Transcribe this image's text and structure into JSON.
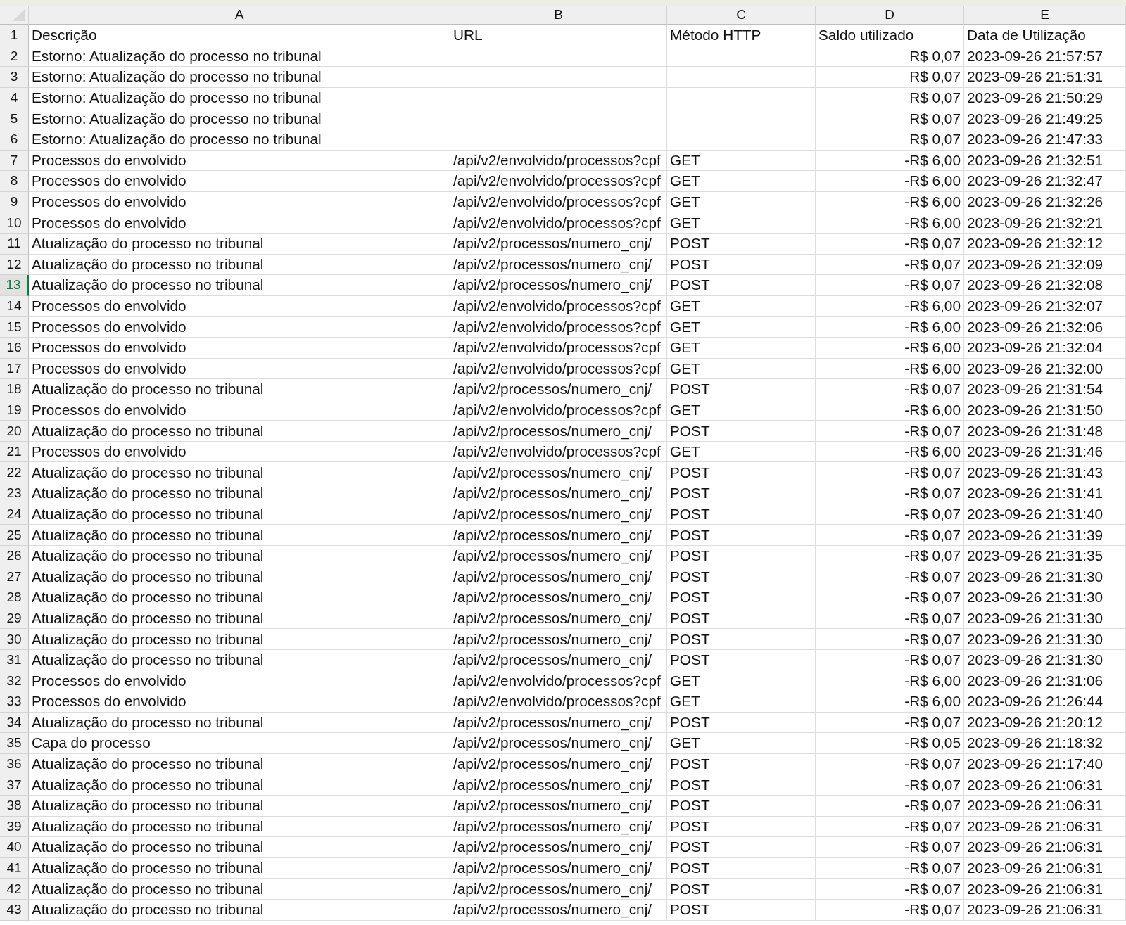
{
  "columns": [
    {
      "letter": "A"
    },
    {
      "letter": "B"
    },
    {
      "letter": "C"
    },
    {
      "letter": "D"
    },
    {
      "letter": "E"
    }
  ],
  "header_row": {
    "number": "1",
    "selected": false,
    "cells": [
      "Descrição",
      "URL",
      "Método HTTP",
      "Saldo utilizado",
      "Data de Utilização"
    ]
  },
  "rows": [
    {
      "number": "2",
      "selected": false,
      "description": "Estorno: Atualização do processo no tribunal",
      "balance": "R$ 0,07",
      "date": "2023-09-26 21:57:57"
    },
    {
      "number": "3",
      "selected": false,
      "description": "Estorno: Atualização do processo no tribunal",
      "balance": "R$ 0,07",
      "date": "2023-09-26 21:51:31"
    },
    {
      "number": "4",
      "selected": false,
      "description": "Estorno: Atualização do processo no tribunal",
      "balance": "R$ 0,07",
      "date": "2023-09-26 21:50:29"
    },
    {
      "number": "5",
      "selected": false,
      "description": "Estorno: Atualização do processo no tribunal",
      "balance": "R$ 0,07",
      "date": "2023-09-26 21:49:25"
    },
    {
      "number": "6",
      "selected": false,
      "description": "Estorno: Atualização do processo no tribunal",
      "balance": "R$ 0,07",
      "date": "2023-09-26 21:47:33"
    },
    {
      "number": "7",
      "selected": false,
      "description": "Processos do envolvido",
      "url": "/api/v2/envolvido/processos?cpf",
      "method": "GET",
      "balance": "-R$ 6,00",
      "date": "2023-09-26 21:32:51"
    },
    {
      "number": "8",
      "selected": false,
      "description": "Processos do envolvido",
      "url": "/api/v2/envolvido/processos?cpf",
      "method": "GET",
      "balance": "-R$ 6,00",
      "date": "2023-09-26 21:32:47"
    },
    {
      "number": "9",
      "selected": false,
      "description": "Processos do envolvido",
      "url": "/api/v2/envolvido/processos?cpf",
      "method": "GET",
      "balance": "-R$ 6,00",
      "date": "2023-09-26 21:32:26"
    },
    {
      "number": "10",
      "selected": false,
      "description": "Processos do envolvido",
      "url": "/api/v2/envolvido/processos?cpf",
      "method": "GET",
      "balance": "-R$ 6,00",
      "date": "2023-09-26 21:32:21"
    },
    {
      "number": "11",
      "selected": false,
      "description": "Atualização do processo no tribunal",
      "url": "/api/v2/processos/numero_cnj/",
      "method": "POST",
      "balance": "-R$ 0,07",
      "date": "2023-09-26 21:32:12"
    },
    {
      "number": "12",
      "selected": false,
      "description": "Atualização do processo no tribunal",
      "url": "/api/v2/processos/numero_cnj/",
      "method": "POST",
      "balance": "-R$ 0,07",
      "date": "2023-09-26 21:32:09"
    },
    {
      "number": "13",
      "selected": true,
      "description": "Atualização do processo no tribunal",
      "url": "/api/v2/processos/numero_cnj/",
      "method": "POST",
      "balance": "-R$ 0,07",
      "date": "2023-09-26 21:32:08"
    },
    {
      "number": "14",
      "selected": false,
      "description": "Processos do envolvido",
      "url": "/api/v2/envolvido/processos?cpf",
      "method": "GET",
      "balance": "-R$ 6,00",
      "date": "2023-09-26 21:32:07"
    },
    {
      "number": "15",
      "selected": false,
      "description": "Processos do envolvido",
      "url": "/api/v2/envolvido/processos?cpf",
      "method": "GET",
      "balance": "-R$ 6,00",
      "date": "2023-09-26 21:32:06"
    },
    {
      "number": "16",
      "selected": false,
      "description": "Processos do envolvido",
      "url": "/api/v2/envolvido/processos?cpf",
      "method": "GET",
      "balance": "-R$ 6,00",
      "date": "2023-09-26 21:32:04"
    },
    {
      "number": "17",
      "selected": false,
      "description": "Processos do envolvido",
      "url": "/api/v2/envolvido/processos?cpf",
      "method": "GET",
      "balance": "-R$ 6,00",
      "date": "2023-09-26 21:32:00"
    },
    {
      "number": "18",
      "selected": false,
      "description": "Atualização do processo no tribunal",
      "url": "/api/v2/processos/numero_cnj/",
      "method": "POST",
      "balance": "-R$ 0,07",
      "date": "2023-09-26 21:31:54"
    },
    {
      "number": "19",
      "selected": false,
      "description": "Processos do envolvido",
      "url": "/api/v2/envolvido/processos?cpf",
      "method": "GET",
      "balance": "-R$ 6,00",
      "date": "2023-09-26 21:31:50"
    },
    {
      "number": "20",
      "selected": false,
      "description": "Atualização do processo no tribunal",
      "url": "/api/v2/processos/numero_cnj/",
      "method": "POST",
      "balance": "-R$ 0,07",
      "date": "2023-09-26 21:31:48"
    },
    {
      "number": "21",
      "selected": false,
      "description": "Processos do envolvido",
      "url": "/api/v2/envolvido/processos?cpf",
      "method": "GET",
      "balance": "-R$ 6,00",
      "date": "2023-09-26 21:31:46"
    },
    {
      "number": "22",
      "selected": false,
      "description": "Atualização do processo no tribunal",
      "url": "/api/v2/processos/numero_cnj/",
      "method": "POST",
      "balance": "-R$ 0,07",
      "date": "2023-09-26 21:31:43"
    },
    {
      "number": "23",
      "selected": false,
      "description": "Atualização do processo no tribunal",
      "url": "/api/v2/processos/numero_cnj/",
      "method": "POST",
      "balance": "-R$ 0,07",
      "date": "2023-09-26 21:31:41"
    },
    {
      "number": "24",
      "selected": false,
      "description": "Atualização do processo no tribunal",
      "url": "/api/v2/processos/numero_cnj/",
      "method": "POST",
      "balance": "-R$ 0,07",
      "date": "2023-09-26 21:31:40"
    },
    {
      "number": "25",
      "selected": false,
      "description": "Atualização do processo no tribunal",
      "url": "/api/v2/processos/numero_cnj/",
      "method": "POST",
      "balance": "-R$ 0,07",
      "date": "2023-09-26 21:31:39"
    },
    {
      "number": "26",
      "selected": false,
      "description": "Atualização do processo no tribunal",
      "url": "/api/v2/processos/numero_cnj/",
      "method": "POST",
      "balance": "-R$ 0,07",
      "date": "2023-09-26 21:31:35"
    },
    {
      "number": "27",
      "selected": false,
      "description": "Atualização do processo no tribunal",
      "url": "/api/v2/processos/numero_cnj/",
      "method": "POST",
      "balance": "-R$ 0,07",
      "date": "2023-09-26 21:31:30"
    },
    {
      "number": "28",
      "selected": false,
      "description": "Atualização do processo no tribunal",
      "url": "/api/v2/processos/numero_cnj/",
      "method": "POST",
      "balance": "-R$ 0,07",
      "date": "2023-09-26 21:31:30"
    },
    {
      "number": "29",
      "selected": false,
      "description": "Atualização do processo no tribunal",
      "url": "/api/v2/processos/numero_cnj/",
      "method": "POST",
      "balance": "-R$ 0,07",
      "date": "2023-09-26 21:31:30"
    },
    {
      "number": "30",
      "selected": false,
      "description": "Atualização do processo no tribunal",
      "url": "/api/v2/processos/numero_cnj/",
      "method": "POST",
      "balance": "-R$ 0,07",
      "date": "2023-09-26 21:31:30"
    },
    {
      "number": "31",
      "selected": false,
      "description": "Atualização do processo no tribunal",
      "url": "/api/v2/processos/numero_cnj/",
      "method": "POST",
      "balance": "-R$ 0,07",
      "date": "2023-09-26 21:31:30"
    },
    {
      "number": "32",
      "selected": false,
      "description": "Processos do envolvido",
      "url": "/api/v2/envolvido/processos?cpf",
      "method": "GET",
      "balance": "-R$ 6,00",
      "date": "2023-09-26 21:31:06"
    },
    {
      "number": "33",
      "selected": false,
      "description": "Processos do envolvido",
      "url": "/api/v2/envolvido/processos?cpf",
      "method": "GET",
      "balance": "-R$ 6,00",
      "date": "2023-09-26 21:26:44"
    },
    {
      "number": "34",
      "selected": false,
      "description": "Atualização do processo no tribunal",
      "url": "/api/v2/processos/numero_cnj/",
      "method": "POST",
      "balance": "-R$ 0,07",
      "date": "2023-09-26 21:20:12"
    },
    {
      "number": "35",
      "selected": false,
      "description": "Capa do processo",
      "url": "/api/v2/processos/numero_cnj/",
      "method": "GET",
      "balance": "-R$ 0,05",
      "date": "2023-09-26 21:18:32"
    },
    {
      "number": "36",
      "selected": false,
      "description": "Atualização do processo no tribunal",
      "url": "/api/v2/processos/numero_cnj/",
      "method": "POST",
      "balance": "-R$ 0,07",
      "date": "2023-09-26 21:17:40"
    },
    {
      "number": "37",
      "selected": false,
      "description": "Atualização do processo no tribunal",
      "url": "/api/v2/processos/numero_cnj/",
      "method": "POST",
      "balance": "-R$ 0,07",
      "date": "2023-09-26 21:06:31"
    },
    {
      "number": "38",
      "selected": false,
      "description": "Atualização do processo no tribunal",
      "url": "/api/v2/processos/numero_cnj/",
      "method": "POST",
      "balance": "-R$ 0,07",
      "date": "2023-09-26 21:06:31"
    },
    {
      "number": "39",
      "selected": false,
      "description": "Atualização do processo no tribunal",
      "url": "/api/v2/processos/numero_cnj/",
      "method": "POST",
      "balance": "-R$ 0,07",
      "date": "2023-09-26 21:06:31"
    },
    {
      "number": "40",
      "selected": false,
      "description": "Atualização do processo no tribunal",
      "url": "/api/v2/processos/numero_cnj/",
      "method": "POST",
      "balance": "-R$ 0,07",
      "date": "2023-09-26 21:06:31"
    },
    {
      "number": "41",
      "selected": false,
      "description": "Atualização do processo no tribunal",
      "url": "/api/v2/processos/numero_cnj/",
      "method": "POST",
      "balance": "-R$ 0,07",
      "date": "2023-09-26 21:06:31"
    },
    {
      "number": "42",
      "selected": false,
      "description": "Atualização do processo no tribunal",
      "url": "/api/v2/processos/numero_cnj/",
      "method": "POST",
      "balance": "-R$ 0,07",
      "date": "2023-09-26 21:06:31"
    },
    {
      "number": "43",
      "selected": false,
      "description": "Atualização do processo no tribunal",
      "url": "/api/v2/processos/numero_cnj/",
      "method": "POST",
      "balance": "-R$ 0,07",
      "date": "2023-09-26 21:06:31"
    }
  ]
}
